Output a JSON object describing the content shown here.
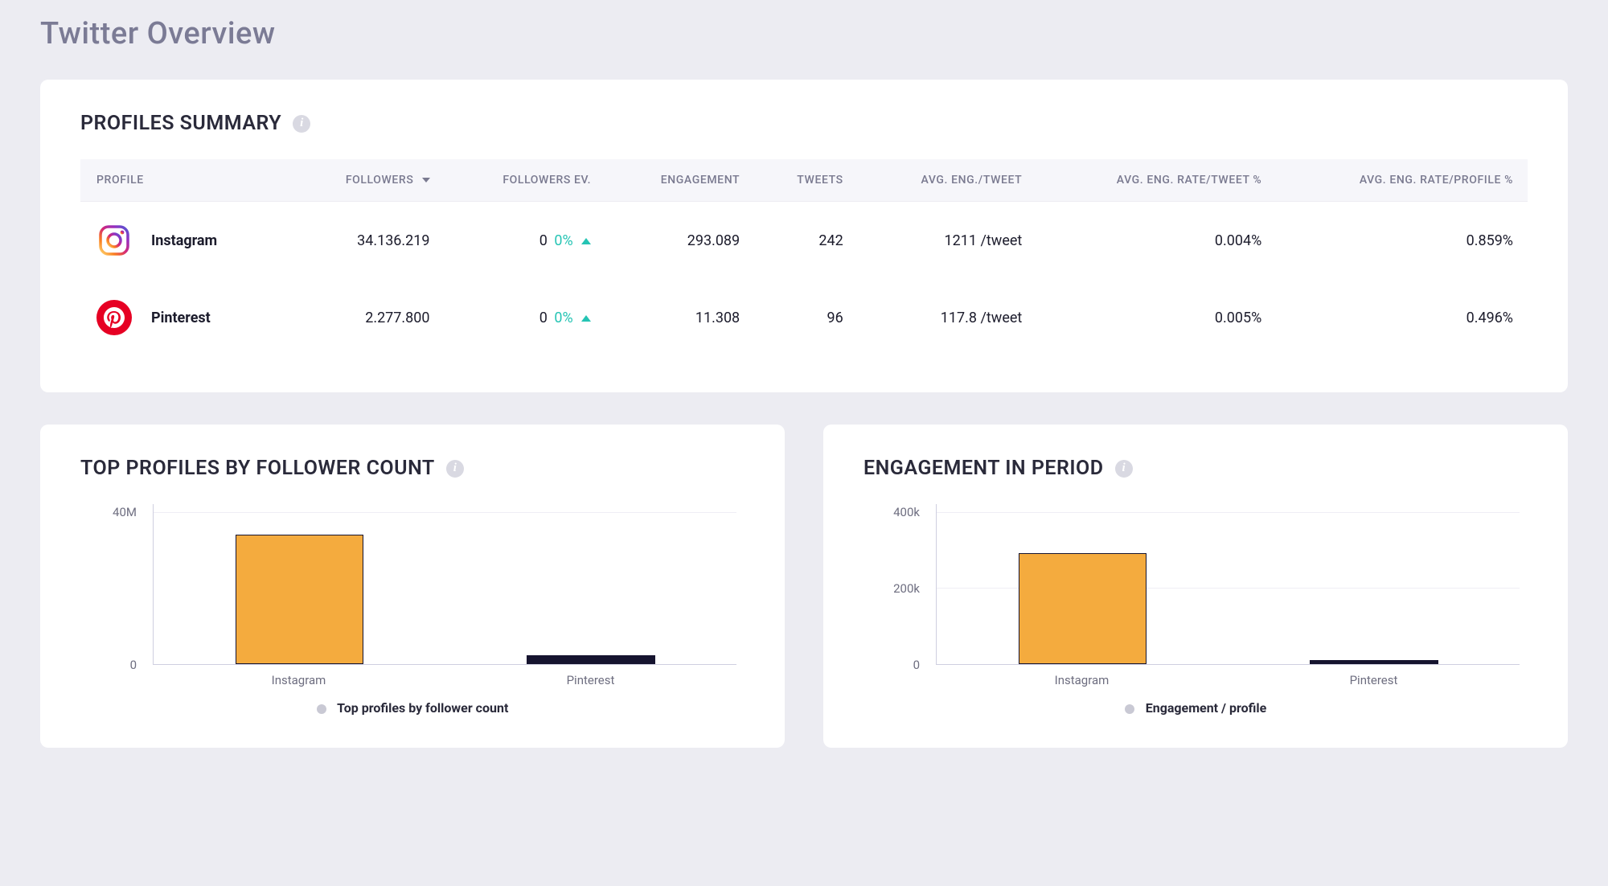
{
  "page": {
    "title": "Twitter Overview"
  },
  "summary": {
    "heading": "PROFILES SUMMARY",
    "columns": {
      "profile": "PROFILE",
      "followers": "FOLLOWERS",
      "followers_ev": "FOLLOWERS EV.",
      "engagement": "ENGAGEMENT",
      "tweets": "TWEETS",
      "avg_eng_tweet": "AVG. ENG./TWEET",
      "avg_eng_rate_tweet": "AVG. ENG. RATE/TWEET %",
      "avg_eng_rate_profile": "AVG. ENG. RATE/PROFILE %"
    },
    "rows": [
      {
        "name": "Instagram",
        "followers": "34.136.219",
        "ev_val": "0",
        "ev_pct": "0%",
        "engagement": "293.089",
        "tweets": "242",
        "avg_eng_tweet": "1211 /tweet",
        "avg_rate_tweet": "0.004%",
        "avg_rate_profile": "0.859%"
      },
      {
        "name": "Pinterest",
        "followers": "2.277.800",
        "ev_val": "0",
        "ev_pct": "0%",
        "engagement": "11.308",
        "tweets": "96",
        "avg_eng_tweet": "117.8 /tweet",
        "avg_rate_tweet": "0.005%",
        "avg_rate_profile": "0.496%"
      }
    ]
  },
  "chart_left": {
    "heading": "TOP PROFILES BY FOLLOWER COUNT",
    "legend": "Top profiles by follower count",
    "y_ticks": [
      "40M",
      "0"
    ]
  },
  "chart_right": {
    "heading": "ENGAGEMENT IN PERIOD",
    "legend": "Engagement / profile",
    "y_ticks": [
      "400k",
      "200k",
      "0"
    ]
  },
  "chart_data": [
    {
      "type": "bar",
      "title": "Top profiles by follower count",
      "categories": [
        "Instagram",
        "Pinterest"
      ],
      "values": [
        34136219,
        2277800
      ],
      "ylabel": "",
      "ylim": [
        0,
        40000000
      ],
      "y_tick_labels": [
        "0",
        "40M"
      ]
    },
    {
      "type": "bar",
      "title": "Engagement / profile",
      "categories": [
        "Instagram",
        "Pinterest"
      ],
      "values": [
        293089,
        11308
      ],
      "ylabel": "",
      "ylim": [
        0,
        400000
      ],
      "y_tick_labels": [
        "0",
        "200k",
        "400k"
      ]
    }
  ]
}
